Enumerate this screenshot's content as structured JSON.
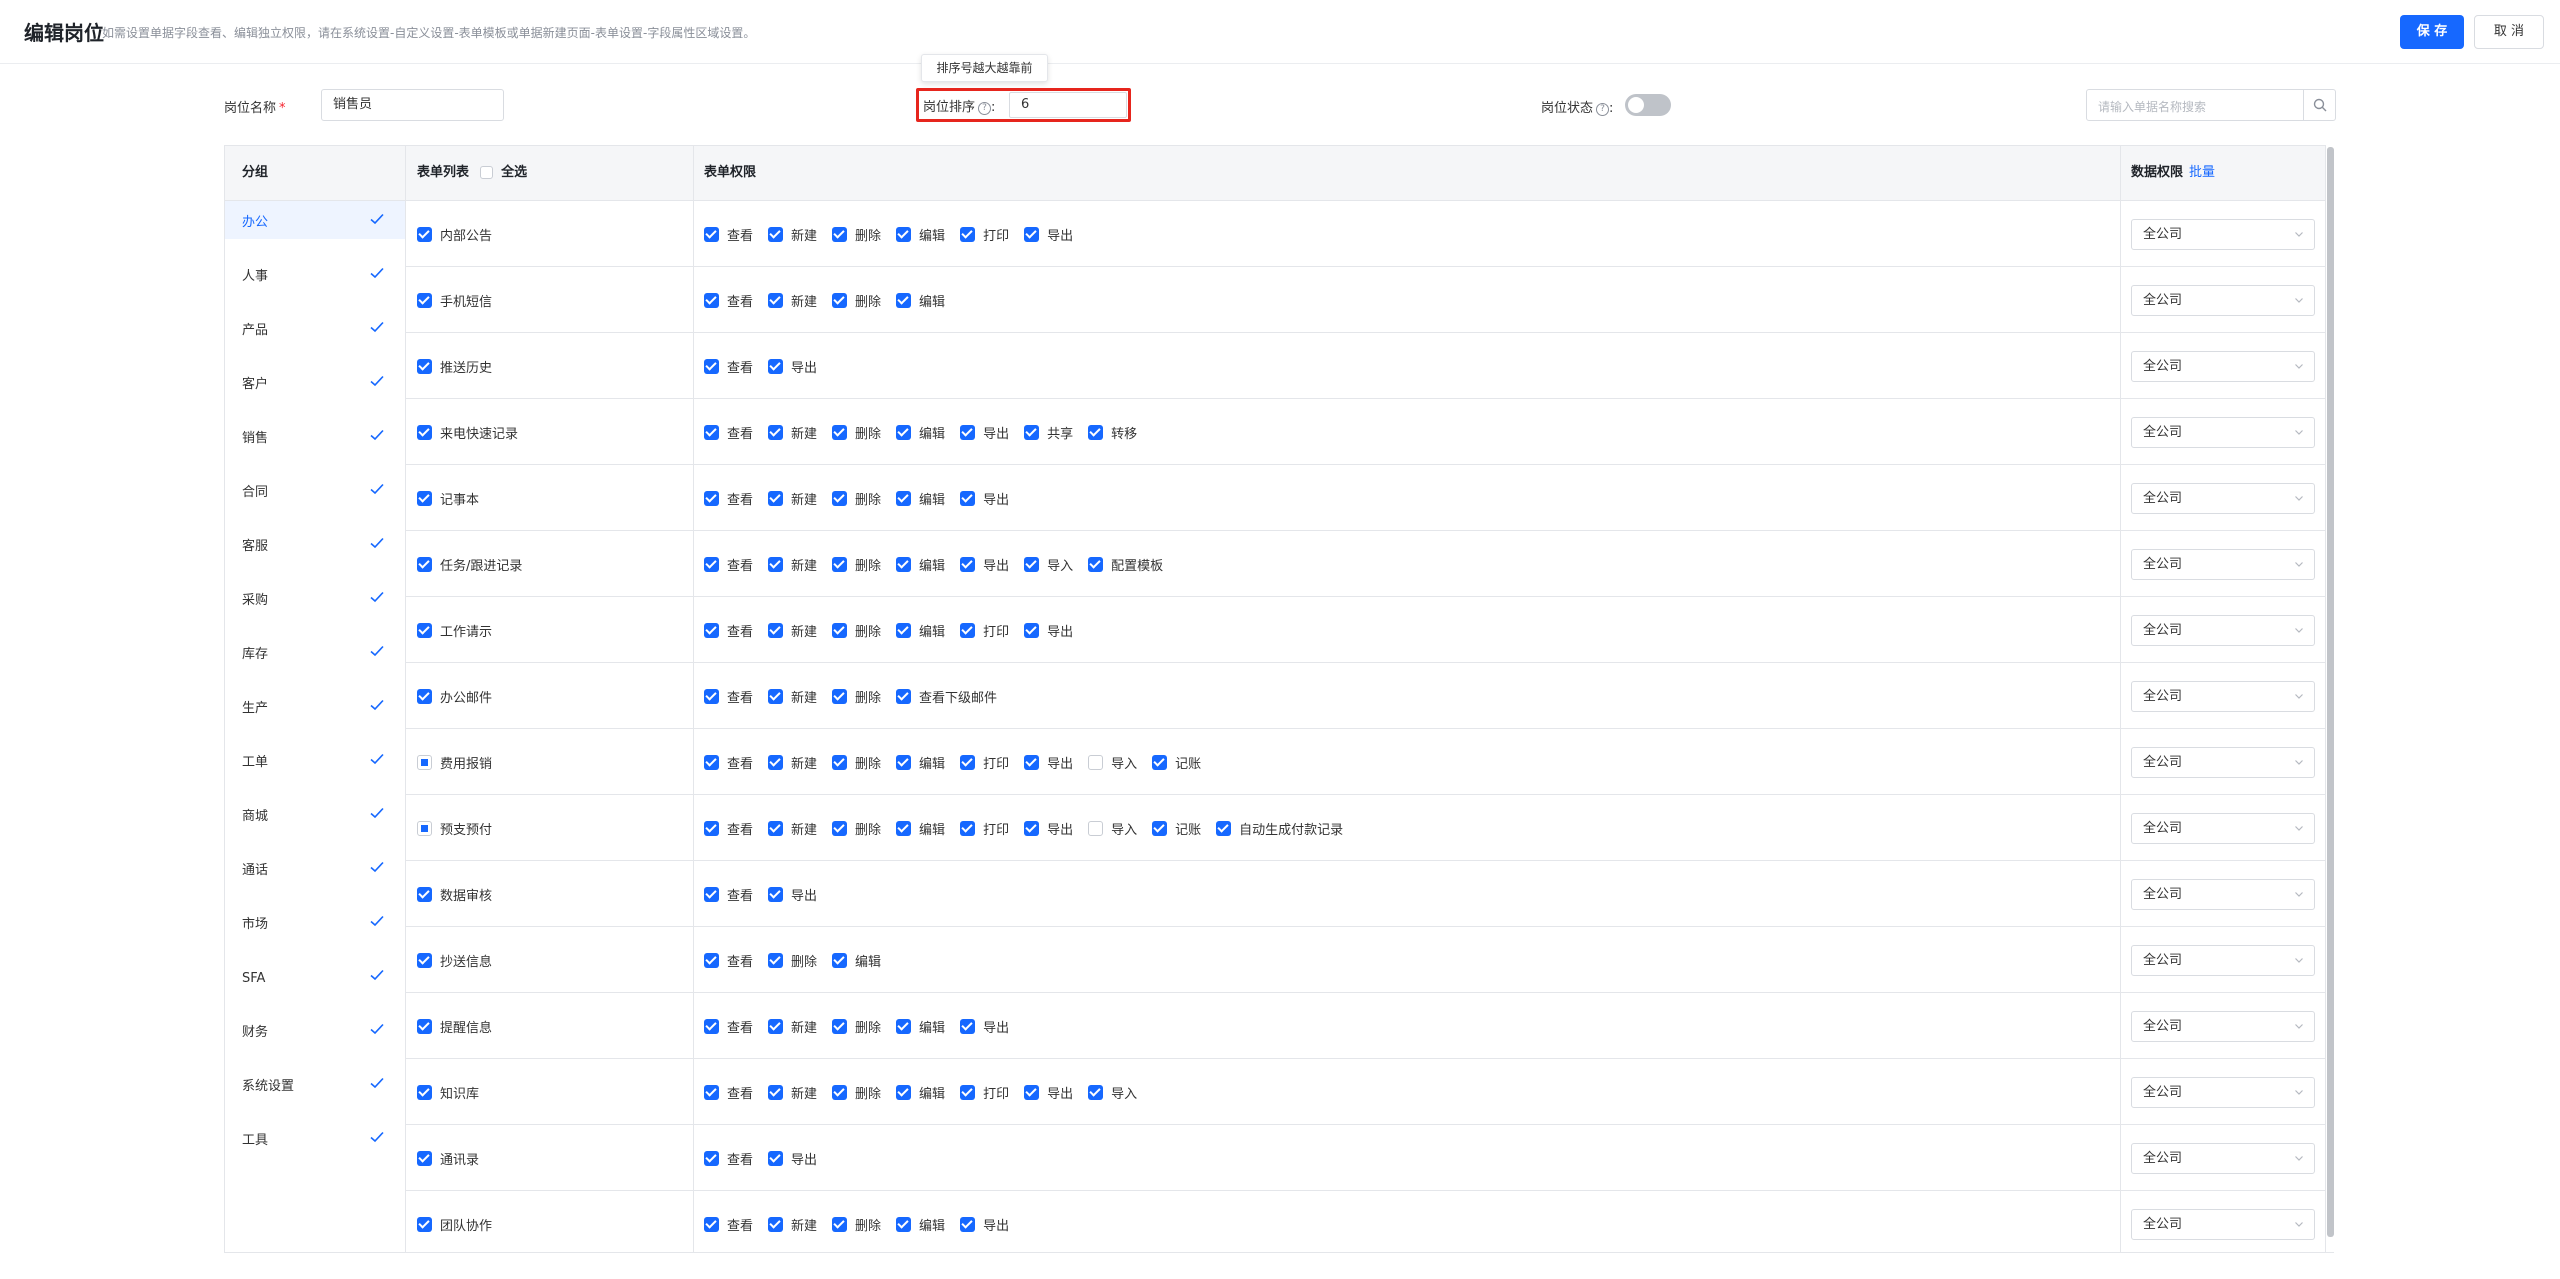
{
  "header": {
    "title": "编辑岗位",
    "description": "如需设置单据字段查看、编辑独立权限，请在系统设置-自定义设置-表单模板或单据新建页面-表单设置-字段属性区域设置。",
    "save_label": "保 存",
    "cancel_label": "取 消"
  },
  "form": {
    "name_label": "岗位名称",
    "name_required": "*",
    "name_value": "销售员",
    "sort_label": "岗位排序",
    "sort_help_icon": "question-circle-icon",
    "sort_colon": ":",
    "sort_value": "6",
    "sort_tooltip": "排序号越大越靠前",
    "status_label": "岗位状态",
    "status_colon": ":",
    "status_on": false,
    "search_placeholder": "请输入单据名称搜索"
  },
  "groups": {
    "header": "分组",
    "items": [
      {
        "label": "办公",
        "checked": true,
        "active": true
      },
      {
        "label": "人事",
        "checked": true
      },
      {
        "label": "产品",
        "checked": true
      },
      {
        "label": "客户",
        "checked": true
      },
      {
        "label": "销售",
        "checked": true
      },
      {
        "label": "合同",
        "checked": true
      },
      {
        "label": "客服",
        "checked": true
      },
      {
        "label": "采购",
        "checked": true
      },
      {
        "label": "库存",
        "checked": true
      },
      {
        "label": "生产",
        "checked": true
      },
      {
        "label": "工单",
        "checked": true
      },
      {
        "label": "商城",
        "checked": true
      },
      {
        "label": "通话",
        "checked": true
      },
      {
        "label": "市场",
        "checked": true
      },
      {
        "label": "SFA",
        "checked": true
      },
      {
        "label": "财务",
        "checked": true
      },
      {
        "label": "系统设置",
        "checked": true
      },
      {
        "label": "工具",
        "checked": true
      }
    ]
  },
  "table": {
    "col_forms": "表单列表",
    "select_all": "全选",
    "col_perms": "表单权限",
    "col_data": "数据权限",
    "batch_link": "批量",
    "rows": [
      {
        "form": "内部公告",
        "state": "on",
        "perms": [
          [
            "查看",
            1
          ],
          [
            "新建",
            1
          ],
          [
            "删除",
            1
          ],
          [
            "编辑",
            1
          ],
          [
            "打印",
            1
          ],
          [
            "导出",
            1
          ]
        ],
        "scope": "全公司"
      },
      {
        "form": "手机短信",
        "state": "on",
        "perms": [
          [
            "查看",
            1
          ],
          [
            "新建",
            1
          ],
          [
            "删除",
            1
          ],
          [
            "编辑",
            1
          ]
        ],
        "scope": "全公司"
      },
      {
        "form": "推送历史",
        "state": "on",
        "perms": [
          [
            "查看",
            1
          ],
          [
            "导出",
            1
          ]
        ],
        "scope": "全公司"
      },
      {
        "form": "来电快速记录",
        "state": "on",
        "perms": [
          [
            "查看",
            1
          ],
          [
            "新建",
            1
          ],
          [
            "删除",
            1
          ],
          [
            "编辑",
            1
          ],
          [
            "导出",
            1
          ],
          [
            "共享",
            1
          ],
          [
            "转移",
            1
          ]
        ],
        "scope": "全公司"
      },
      {
        "form": "记事本",
        "state": "on",
        "perms": [
          [
            "查看",
            1
          ],
          [
            "新建",
            1
          ],
          [
            "删除",
            1
          ],
          [
            "编辑",
            1
          ],
          [
            "导出",
            1
          ]
        ],
        "scope": "全公司"
      },
      {
        "form": "任务/跟进记录",
        "state": "on",
        "perms": [
          [
            "查看",
            1
          ],
          [
            "新建",
            1
          ],
          [
            "删除",
            1
          ],
          [
            "编辑",
            1
          ],
          [
            "导出",
            1
          ],
          [
            "导入",
            1
          ],
          [
            "配置模板",
            1
          ]
        ],
        "scope": "全公司"
      },
      {
        "form": "工作请示",
        "state": "on",
        "perms": [
          [
            "查看",
            1
          ],
          [
            "新建",
            1
          ],
          [
            "删除",
            1
          ],
          [
            "编辑",
            1
          ],
          [
            "打印",
            1
          ],
          [
            "导出",
            1
          ]
        ],
        "scope": "全公司"
      },
      {
        "form": "办公邮件",
        "state": "on",
        "perms": [
          [
            "查看",
            1
          ],
          [
            "新建",
            1
          ],
          [
            "删除",
            1
          ],
          [
            "查看下级邮件",
            1
          ]
        ],
        "scope": "全公司"
      },
      {
        "form": "费用报销",
        "state": "partial",
        "perms": [
          [
            "查看",
            1
          ],
          [
            "新建",
            1
          ],
          [
            "删除",
            1
          ],
          [
            "编辑",
            1
          ],
          [
            "打印",
            1
          ],
          [
            "导出",
            1
          ],
          [
            "导入",
            0
          ],
          [
            "记账",
            1
          ]
        ],
        "scope": "全公司"
      },
      {
        "form": "预支预付",
        "state": "partial",
        "perms": [
          [
            "查看",
            1
          ],
          [
            "新建",
            1
          ],
          [
            "删除",
            1
          ],
          [
            "编辑",
            1
          ],
          [
            "打印",
            1
          ],
          [
            "导出",
            1
          ],
          [
            "导入",
            0
          ],
          [
            "记账",
            1
          ],
          [
            "自动生成付款记录",
            1
          ]
        ],
        "scope": "全公司"
      },
      {
        "form": "数据审核",
        "state": "on",
        "perms": [
          [
            "查看",
            1
          ],
          [
            "导出",
            1
          ]
        ],
        "scope": "全公司"
      },
      {
        "form": "抄送信息",
        "state": "on",
        "perms": [
          [
            "查看",
            1
          ],
          [
            "删除",
            1
          ],
          [
            "编辑",
            1
          ]
        ],
        "scope": "全公司"
      },
      {
        "form": "提醒信息",
        "state": "on",
        "perms": [
          [
            "查看",
            1
          ],
          [
            "新建",
            1
          ],
          [
            "删除",
            1
          ],
          [
            "编辑",
            1
          ],
          [
            "导出",
            1
          ]
        ],
        "scope": "全公司"
      },
      {
        "form": "知识库",
        "state": "on",
        "perms": [
          [
            "查看",
            1
          ],
          [
            "新建",
            1
          ],
          [
            "删除",
            1
          ],
          [
            "编辑",
            1
          ],
          [
            "打印",
            1
          ],
          [
            "导出",
            1
          ],
          [
            "导入",
            1
          ]
        ],
        "scope": "全公司"
      },
      {
        "form": "通讯录",
        "state": "on",
        "perms": [
          [
            "查看",
            1
          ],
          [
            "导出",
            1
          ]
        ],
        "scope": "全公司"
      },
      {
        "form": "团队协作",
        "state": "on",
        "perms": [
          [
            "查看",
            1
          ],
          [
            "新建",
            1
          ],
          [
            "删除",
            1
          ],
          [
            "编辑",
            1
          ],
          [
            "导出",
            1
          ]
        ],
        "scope": "全公司"
      }
    ]
  },
  "colors": {
    "primary": "#1668ff",
    "highlight_border": "#e6251d",
    "check_icon": "check-icon",
    "dropdown_icon": "chevron-down-icon",
    "search_icon": "search-icon"
  }
}
